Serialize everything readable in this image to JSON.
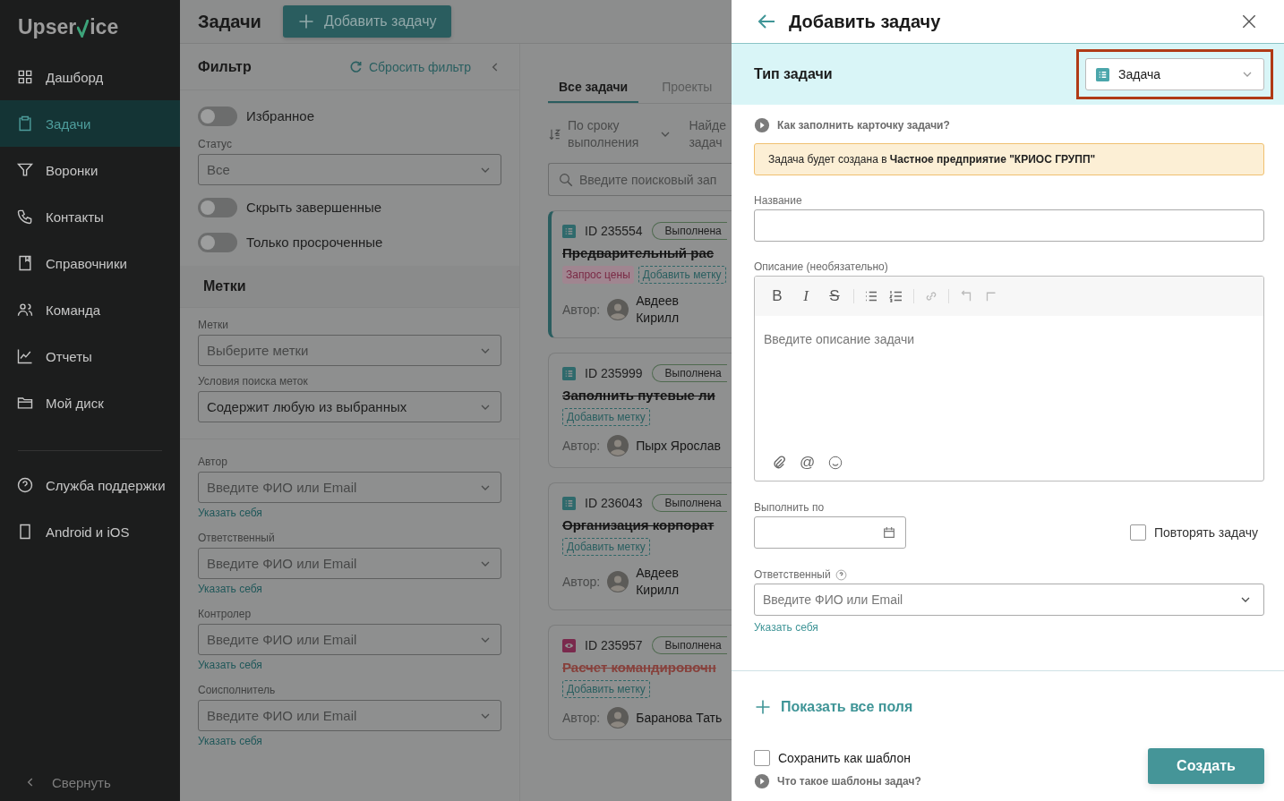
{
  "sidebar": {
    "logo_start": "Upser",
    "logo_end": "ice",
    "items": [
      {
        "label": "Дашборд",
        "selected": false
      },
      {
        "label": "Задачи",
        "selected": true
      },
      {
        "label": "Воронки",
        "selected": false
      },
      {
        "label": "Контакты",
        "selected": false
      },
      {
        "label": "Справочники",
        "selected": false
      },
      {
        "label": "Команда",
        "selected": false
      },
      {
        "label": "Отчеты",
        "selected": false
      },
      {
        "label": "Мой диск",
        "selected": false
      }
    ],
    "bottom_items": [
      "Служба поддержки",
      "Android и iOS"
    ],
    "collapse": "Свернуть"
  },
  "header": {
    "title": "Задачи",
    "add_button": "Добавить задачу"
  },
  "filter": {
    "title": "Фильтр",
    "reset": "Сбросить фильтр",
    "controls": [
      {
        "kind": "toggle",
        "label": "Избранное",
        "on": false
      },
      {
        "kind": "select",
        "label": "Статус",
        "value": "Все"
      },
      {
        "kind": "toggle",
        "label": "Скрыть завершенные",
        "on": false
      },
      {
        "kind": "toggle",
        "label": "Только просроченные",
        "on": false
      }
    ],
    "tags_title": "Метки",
    "tag_fields": [
      {
        "label": "Метки",
        "placeholder": "Выберите метки"
      },
      {
        "label": "Условия поиска меток",
        "value": "Содержит любую из выбранных"
      }
    ],
    "people": [
      {
        "label": "Автор",
        "placeholder": "Введите ФИО или Email",
        "link": "Указать себя"
      },
      {
        "label": "Ответственный",
        "placeholder": "Введите ФИО или Email",
        "link": "Указать себя"
      },
      {
        "label": "Контролер",
        "placeholder": "Введите ФИО или Email",
        "link": "Указать себя"
      },
      {
        "label": "Соисполнитель",
        "placeholder": "Введите ФИО или Email",
        "link": "Указать себя"
      }
    ]
  },
  "list": {
    "tabs": [
      {
        "label": "Все задачи",
        "selected": true
      },
      {
        "label": "Проекты",
        "selected": false
      }
    ],
    "sort": [
      "По сроку",
      "выполнения"
    ],
    "found": [
      "Найде",
      "задач"
    ],
    "search": {
      "placeholder": "Введите поисковый зап"
    },
    "cards": [
      {
        "kind": "task",
        "id": "ID 235554",
        "status": "Выполнена",
        "title": "Предварительный рас",
        "overdue": false,
        "selected": true,
        "tags": [
          "Запрос цены"
        ],
        "add_tag": "Добавить метку",
        "author_label": "Автор:",
        "author": [
          "Авдеев",
          "Кирилл"
        ]
      },
      {
        "kind": "task",
        "id": "ID 235999",
        "status": "Выполнена",
        "title": "Заполнить путевые ли",
        "overdue": false,
        "selected": false,
        "add_tag": "Добавить метку",
        "author_label": "Автор:",
        "author": [
          "Пырх Ярослав"
        ]
      },
      {
        "kind": "task",
        "id": "ID 236043",
        "status": "Выполнена",
        "title": "Организация корпорат",
        "overdue": false,
        "selected": false,
        "add_tag": "Добавить метку",
        "author_label": "Автор:",
        "author": [
          "Авдеев",
          "Кирилл"
        ]
      },
      {
        "kind": "view",
        "id": "ID 235957",
        "status": "Выполнена",
        "title": "Расчет командировочн",
        "overdue": true,
        "selected": false,
        "add_tag": "Добавить метку",
        "author_label": "Автор:",
        "author": [
          "Баранова Тать"
        ]
      }
    ]
  },
  "modal": {
    "title": "Добавить задачу",
    "type_label": "Тип задачи",
    "type_value": "Задача",
    "help": "Как заполнить карточку задачи?",
    "notice": "Задача будет создана в **Частное предприятие \"КРИОС ГРУПП\"**",
    "name_label": "Название",
    "desc_label": "Описание (необязательно)",
    "format_buttons": [
      "B",
      "I",
      "S"
    ],
    "mention": "@",
    "desc_placeholder": "Введите описание задачи",
    "due_label": "Выполнить по",
    "repeat": {
      "label": "Повторять задачу",
      "checked": false
    },
    "responsible": {
      "label": "Ответственный",
      "placeholder": "Введите ФИО или Email",
      "link": "Указать себя"
    },
    "show_all": "Показать все поля",
    "template": {
      "label": "Сохранить как шаблон",
      "checked": false
    },
    "template_help": "Что такое шаблоны задач?",
    "submit": "Создать"
  }
}
